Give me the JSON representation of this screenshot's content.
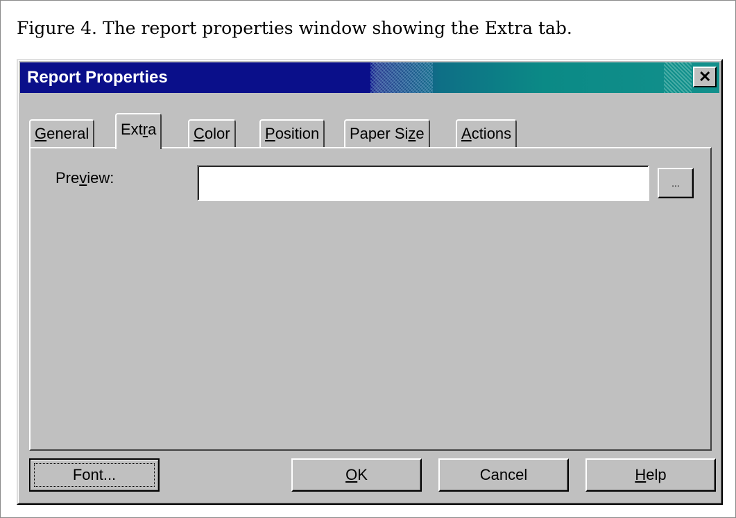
{
  "caption": "Figure 4. The report properties window showing the Extra tab.",
  "window": {
    "title": "Report Properties",
    "close_glyph": "✕"
  },
  "tabs": [
    {
      "pre": "",
      "ul": "G",
      "post": "eneral",
      "active": false
    },
    {
      "pre": "Ext",
      "ul": "r",
      "post": "a",
      "active": true
    },
    {
      "pre": "",
      "ul": "C",
      "post": "olor",
      "active": false
    },
    {
      "pre": "",
      "ul": "P",
      "post": "osition",
      "active": false
    },
    {
      "pre": "Paper Si",
      "ul": "z",
      "post": "e",
      "active": false
    },
    {
      "pre": "",
      "ul": "A",
      "post": "ctions",
      "active": false
    }
  ],
  "extra": {
    "preview_label_pre": "Pre",
    "preview_label_ul": "v",
    "preview_label_post": "iew:",
    "preview_value": "",
    "browse_label": "..."
  },
  "buttons": {
    "font": "Font...",
    "ok_ul": "O",
    "ok_post": "K",
    "cancel": "Cancel",
    "help_ul": "H",
    "help_post": "elp"
  }
}
